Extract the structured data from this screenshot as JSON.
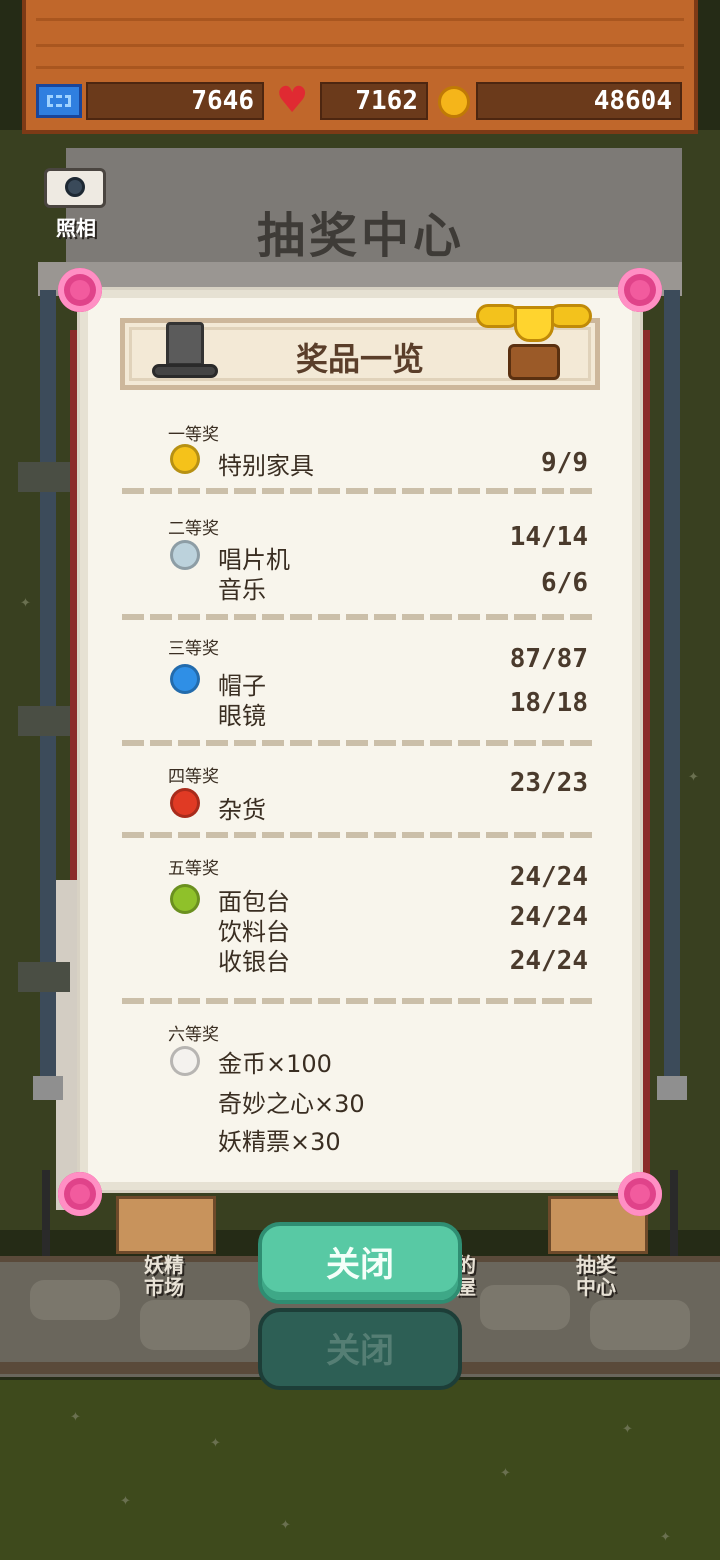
{
  "resources": {
    "tickets": "7646",
    "hearts": "7162",
    "coins": "48604"
  },
  "building": {
    "title": "抽奖中心",
    "camera_label": "照相"
  },
  "panel": {
    "title": "奖品一览",
    "tiers": [
      {
        "label": "一等奖",
        "color": "#f5c21a",
        "items": [
          {
            "name": "特别家具",
            "count": "9/9"
          }
        ]
      },
      {
        "label": "二等奖",
        "color": "#bcd2dc",
        "items": [
          {
            "name": "唱片机",
            "count": "14/14"
          },
          {
            "name": "音乐",
            "count": "6/6"
          }
        ]
      },
      {
        "label": "三等奖",
        "color": "#2f8fe6",
        "items": [
          {
            "name": "帽子",
            "count": "87/87"
          },
          {
            "name": "眼镜",
            "count": "18/18"
          }
        ]
      },
      {
        "label": "四等奖",
        "color": "#e03a24",
        "items": [
          {
            "name": "杂货",
            "count": "23/23"
          }
        ]
      },
      {
        "label": "五等奖",
        "color": "#8fc12a",
        "items": [
          {
            "name": "面包台",
            "count": "24/24"
          },
          {
            "name": "饮料台",
            "count": "24/24"
          },
          {
            "name": "收银台",
            "count": "24/24"
          }
        ]
      },
      {
        "label": "六等奖",
        "color": "#f4f2ee",
        "items": [
          {
            "name": "金币×100"
          },
          {
            "name": "奇妙之心×30"
          },
          {
            "name": "妖精票×30"
          }
        ]
      }
    ]
  },
  "buttons": {
    "close": "关闭",
    "close_shadow": "关闭"
  },
  "bottom_labels": {
    "fairy_market": "妖精\n市场",
    "lottery_center": "抽奖\n中心",
    "partial": "的\n屋"
  },
  "colors": {
    "accent_button": "#58c9a4",
    "panel_bg": "#f8f5ec"
  }
}
